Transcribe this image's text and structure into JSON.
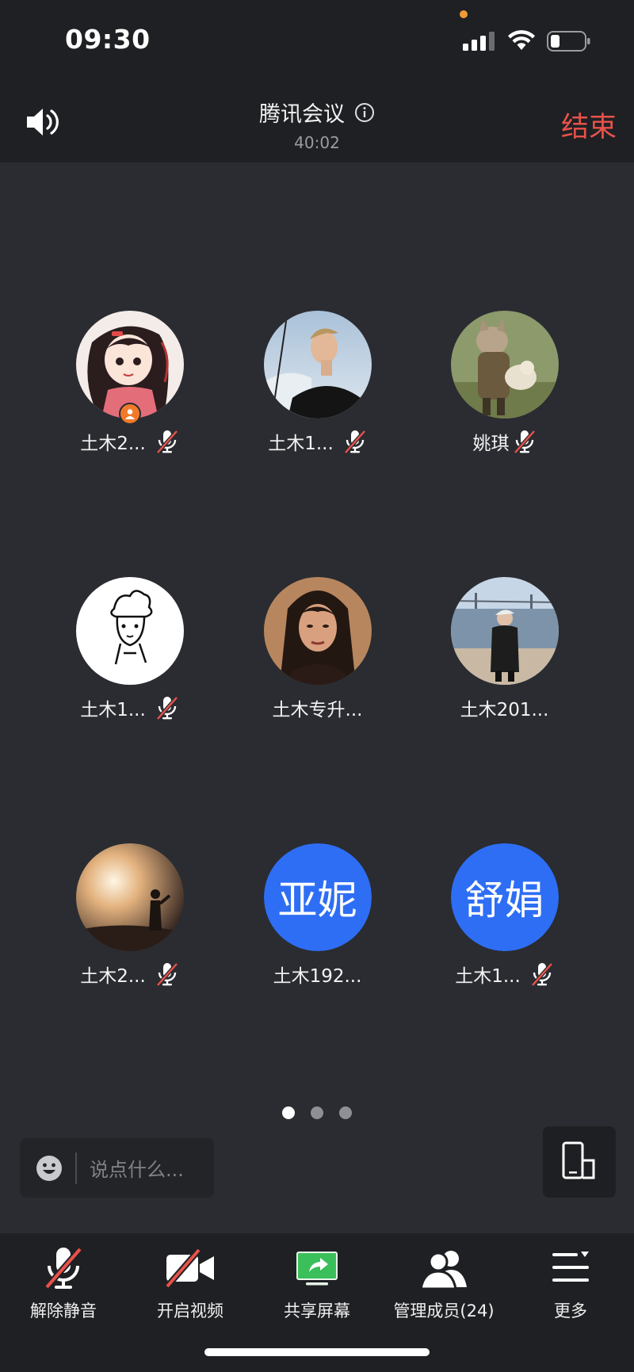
{
  "status_bar": {
    "time": "09:30",
    "icons": [
      "cellular-signal-icon",
      "wifi-icon",
      "battery-icon"
    ]
  },
  "header": {
    "speaker_icon": "speaker-icon",
    "title": "腾讯会议",
    "info_icon": "info-icon",
    "duration": "40:02",
    "end_label": "结束"
  },
  "participants": [
    {
      "name": "土木2...",
      "muted": true,
      "host": true,
      "avatar": "cartoon-girl"
    },
    {
      "name": "土木1...",
      "muted": true,
      "avatar": "photo-man-profile"
    },
    {
      "name": "姚琪",
      "muted": true,
      "avatar": "photo-cat"
    },
    {
      "name": "土木1...",
      "muted": true,
      "avatar": "sketch-boy"
    },
    {
      "name": "土木专升...",
      "muted": false,
      "avatar": "photo-woman"
    },
    {
      "name": "土木201...",
      "muted": false,
      "avatar": "photo-beach"
    },
    {
      "name": "土木2...",
      "muted": true,
      "avatar": "photo-sunset"
    },
    {
      "name": "土木192...",
      "muted": false,
      "avatar_text": "亚妮"
    },
    {
      "name": "土木1...",
      "muted": true,
      "avatar_text": "舒娟"
    }
  ],
  "pagination": {
    "pages": 3,
    "current": 1
  },
  "chat": {
    "placeholder": "说点什么..."
  },
  "toolbar": {
    "unmute": "解除静音",
    "video": "开启视频",
    "share": "共享屏幕",
    "members": "管理成员(24)",
    "more": "更多"
  },
  "colors": {
    "background": "#2a2c31",
    "header_bg": "#1f2023",
    "end_red": "#e8524a",
    "avatar_blue": "#2e6ef5",
    "host_orange": "#f07a2a",
    "share_green": "#3bbf5a"
  }
}
